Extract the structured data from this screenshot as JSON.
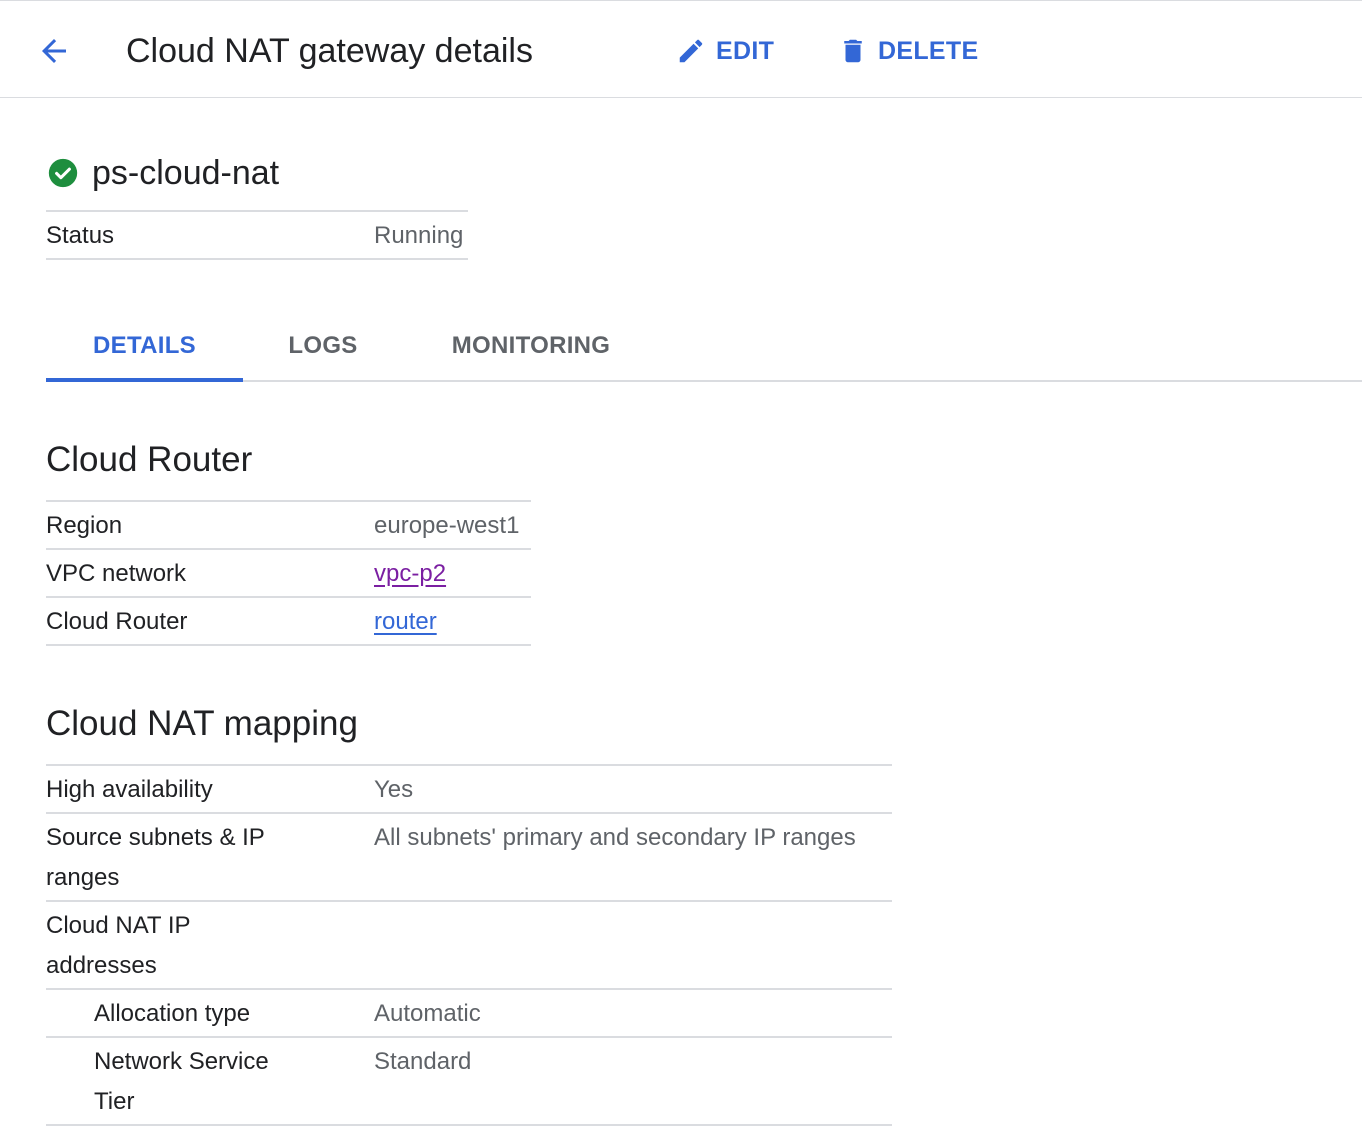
{
  "header": {
    "title": "Cloud NAT gateway details",
    "edit_label": "EDIT",
    "delete_label": "DELETE"
  },
  "resource": {
    "name": "ps-cloud-nat",
    "status_key": "Status",
    "status_value": "Running",
    "status_color": "#1e8e3e"
  },
  "tabs": [
    {
      "label": "DETAILS",
      "active": true
    },
    {
      "label": "LOGS",
      "active": false
    },
    {
      "label": "MONITORING",
      "active": false
    }
  ],
  "cloud_router": {
    "title": "Cloud Router",
    "rows": [
      {
        "key": "Region",
        "value": "europe-west1"
      },
      {
        "key": "VPC network",
        "value": "vpc-p2"
      },
      {
        "key": "Cloud Router",
        "value": "router"
      }
    ]
  },
  "nat_mapping": {
    "title": "Cloud NAT mapping",
    "rows": [
      {
        "key": "High availability",
        "value": "Yes"
      },
      {
        "key": "Source subnets & IP ranges",
        "value": "All subnets' primary and secondary IP ranges"
      },
      {
        "key": "Cloud NAT IP addresses",
        "value": ""
      },
      {
        "key": "Allocation type",
        "value": "Automatic"
      },
      {
        "key": "Network Service Tier",
        "value": "Standard"
      }
    ]
  },
  "colors": {
    "accent": "#3367d6",
    "visited_link": "#7b1fa2",
    "divider": "#dadce0"
  }
}
